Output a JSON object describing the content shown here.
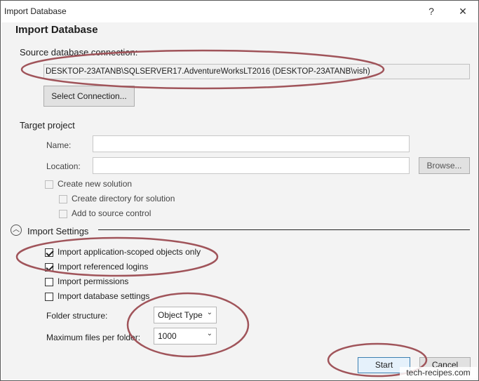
{
  "window": {
    "title": "Import Database",
    "help_glyph": "?",
    "close_glyph": "✕"
  },
  "heading": "Import Database",
  "source": {
    "label": "Source database connection:",
    "value": "DESKTOP-23ATANB\\SQLSERVER17.AdventureWorksLT2016 (DESKTOP-23ATANB\\vish)",
    "select_button": "Select Connection..."
  },
  "target": {
    "label": "Target project",
    "name_label": "Name:",
    "location_label": "Location:",
    "browse_button": "Browse...",
    "create_solution": "Create new solution",
    "create_directory": "Create directory for solution",
    "add_source_control": "Add to source control"
  },
  "import_settings": {
    "label": "Import Settings",
    "expand_glyph": "︿",
    "options": [
      {
        "label": "Import application-scoped objects only",
        "checked": true
      },
      {
        "label": "Import referenced logins",
        "checked": true
      },
      {
        "label": "Import permissions",
        "checked": false
      },
      {
        "label": "Import database settings",
        "checked": false
      }
    ],
    "folder_structure_label": "Folder structure:",
    "folder_structure_value": "Object Type",
    "max_files_label": "Maximum files per folder:",
    "max_files_value": "1000",
    "dropdown_glyph": "⌄"
  },
  "footer": {
    "start_button": "Start",
    "cancel_button": "Cancel"
  },
  "watermark": "tech-recipes.com",
  "colors": {
    "annotation": "#a0545a",
    "accent": "#3c7fb1"
  }
}
